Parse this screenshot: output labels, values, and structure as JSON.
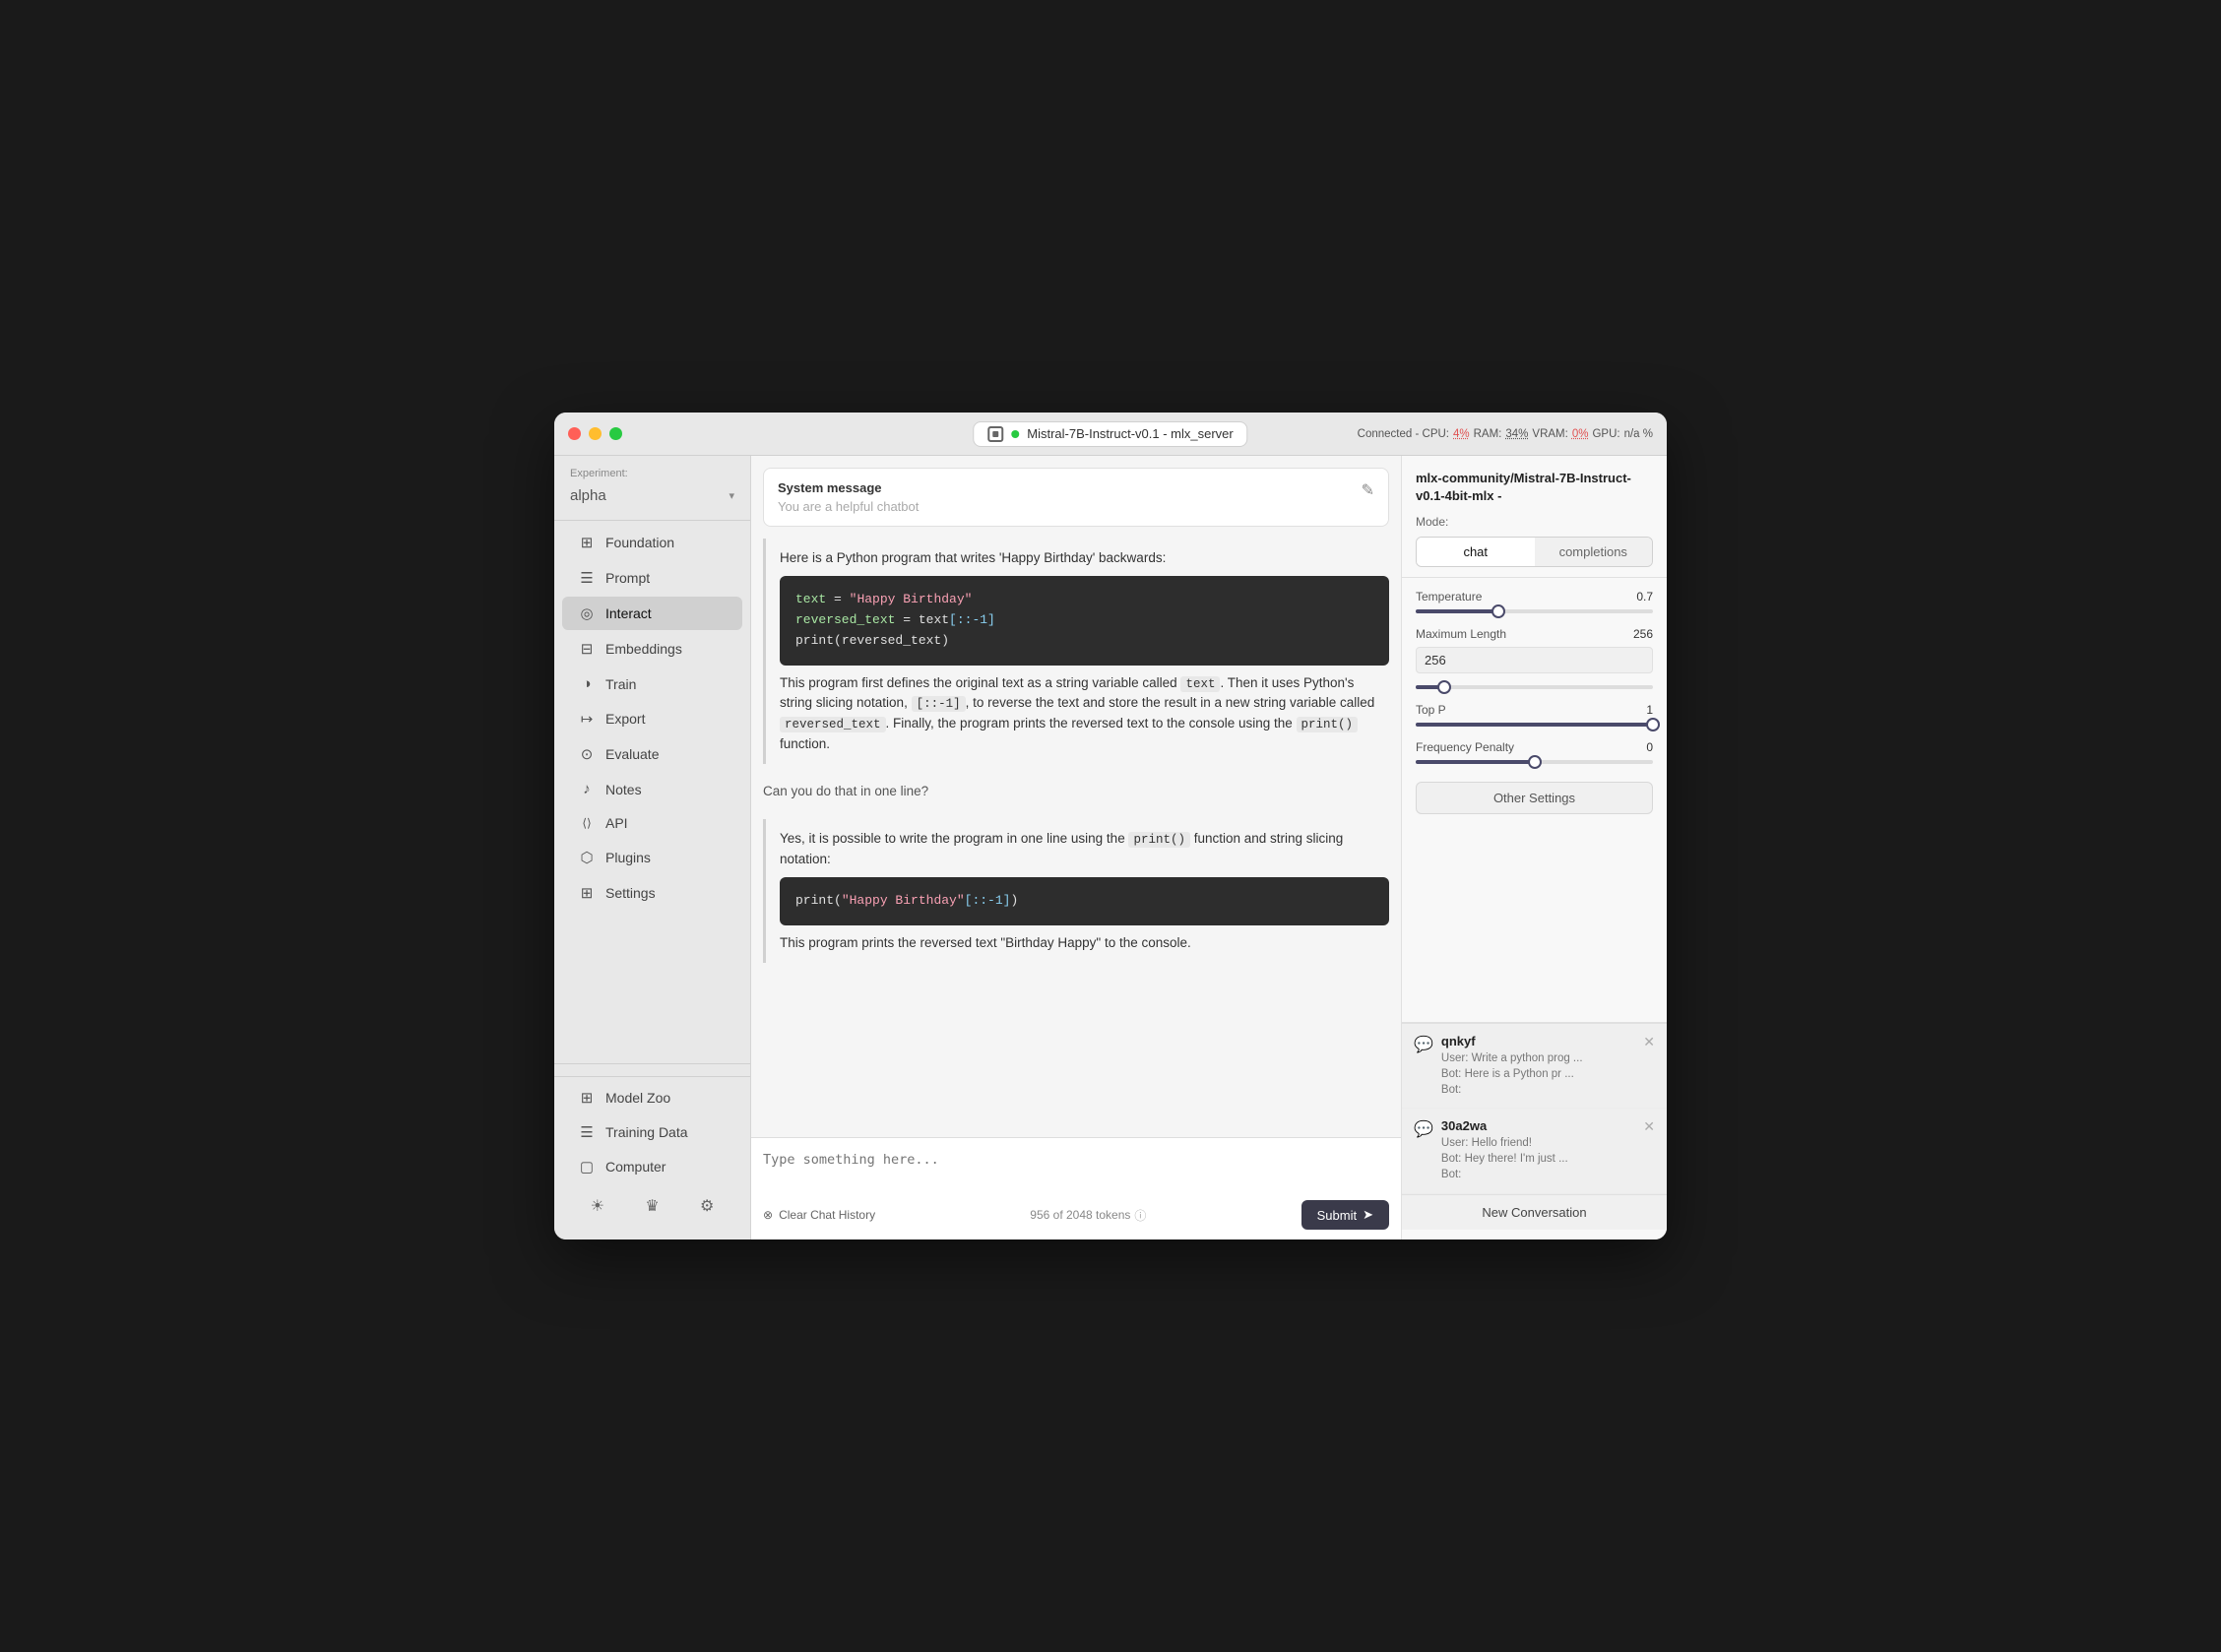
{
  "window": {
    "title": "Mistral-7B-Instruct-v0.1 - mlx_server"
  },
  "titlebar": {
    "model_name": "Mistral-7B-Instruct-v0.1",
    "model_suffix": "mlx_server",
    "status": "Connected - CPU:",
    "cpu": "4%",
    "ram_label": "RAM:",
    "ram": "34%",
    "vram_label": "VRAM:",
    "vram": "0%",
    "gpu_label": "GPU:",
    "gpu": "n/a %"
  },
  "sidebar": {
    "experiment_label": "Experiment:",
    "experiment_name": "alpha",
    "nav_items": [
      {
        "id": "foundation",
        "label": "Foundation",
        "icon": "⊞"
      },
      {
        "id": "prompt",
        "label": "Prompt",
        "icon": "☰"
      },
      {
        "id": "interact",
        "label": "Interact",
        "icon": "◎"
      },
      {
        "id": "embeddings",
        "label": "Embeddings",
        "icon": "⊟"
      },
      {
        "id": "train",
        "label": "Train",
        "icon": "◑"
      },
      {
        "id": "export",
        "label": "Export",
        "icon": "↦"
      },
      {
        "id": "evaluate",
        "label": "Evaluate",
        "icon": "⊙"
      },
      {
        "id": "notes",
        "label": "Notes",
        "icon": "♪"
      },
      {
        "id": "api",
        "label": "API",
        "icon": "⟨⟩"
      },
      {
        "id": "plugins",
        "label": "Plugins",
        "icon": "⬡"
      },
      {
        "id": "settings",
        "label": "Settings",
        "icon": "⊞"
      }
    ],
    "bottom_nav": [
      {
        "id": "model-zoo",
        "label": "Model Zoo",
        "icon": "⊞"
      },
      {
        "id": "training-data",
        "label": "Training Data",
        "icon": "☰"
      },
      {
        "id": "computer",
        "label": "Computer",
        "icon": "▢"
      }
    ],
    "bottom_icons": [
      "☀",
      "♛",
      "⚙"
    ]
  },
  "system_message": {
    "label": "System message",
    "placeholder": "You are a helpful chatbot"
  },
  "chat": {
    "messages": [
      {
        "type": "bot",
        "text": "Here is a Python program that writes 'Happy Birthday' backwards:",
        "code": "text = \"Happy Birthday\"\nreversed_text = text[::-1]\nprint(reversed_text)",
        "after_text": "This program first defines the original text as a string variable called text. Then it uses Python's string slicing notation, [::-1], to reverse the text and store the result in a new string variable called reversed_text. Finally, the program prints the reversed text to the console using the print() function."
      },
      {
        "type": "user",
        "text": "Can you do that in one line?"
      },
      {
        "type": "bot",
        "text": "Yes, it is possible to write the program in one line using the print() function and string slicing notation:",
        "code": "print(\"Happy Birthday\"[::-1])",
        "after_text": "This program prints the reversed text \"Birthday Happy\" to the console."
      }
    ],
    "input_placeholder": "Type something here...",
    "clear_label": "Clear Chat History",
    "token_info": "956 of 2048 tokens",
    "submit_label": "Submit"
  },
  "right_panel": {
    "model_title": "mlx-community/Mistral-7B-Instruct-v0.1-4bit-mlx -",
    "mode_label": "Mode:",
    "modes": [
      "chat",
      "completions"
    ],
    "active_mode": "chat",
    "params": {
      "temperature_label": "Temperature",
      "temperature_value": "0.7",
      "temperature_pct": 35,
      "max_length_label": "Maximum Length",
      "max_length_value": "256",
      "max_length_input": "256",
      "max_length_pct": 12,
      "top_p_label": "Top P",
      "top_p_value": "1",
      "top_p_pct": 100,
      "frequency_penalty_label": "Frequency Penalty",
      "frequency_penalty_value": "0",
      "frequency_penalty_pct": 50
    },
    "other_settings_label": "Other Settings",
    "conversations": [
      {
        "id": "qnkyf",
        "title": "qnkyf",
        "preview_user": "User:  Write a python prog ...",
        "preview_bot1": "Bot:  Here is a Python pr ...",
        "preview_bot2": "Bot:"
      },
      {
        "id": "30a2wa",
        "title": "30a2wa",
        "preview_user": "User:  Hello friend!",
        "preview_bot1": "Bot:  Hey there! I'm just ...",
        "preview_bot2": "Bot:"
      }
    ],
    "new_conv_label": "New Conversation"
  }
}
